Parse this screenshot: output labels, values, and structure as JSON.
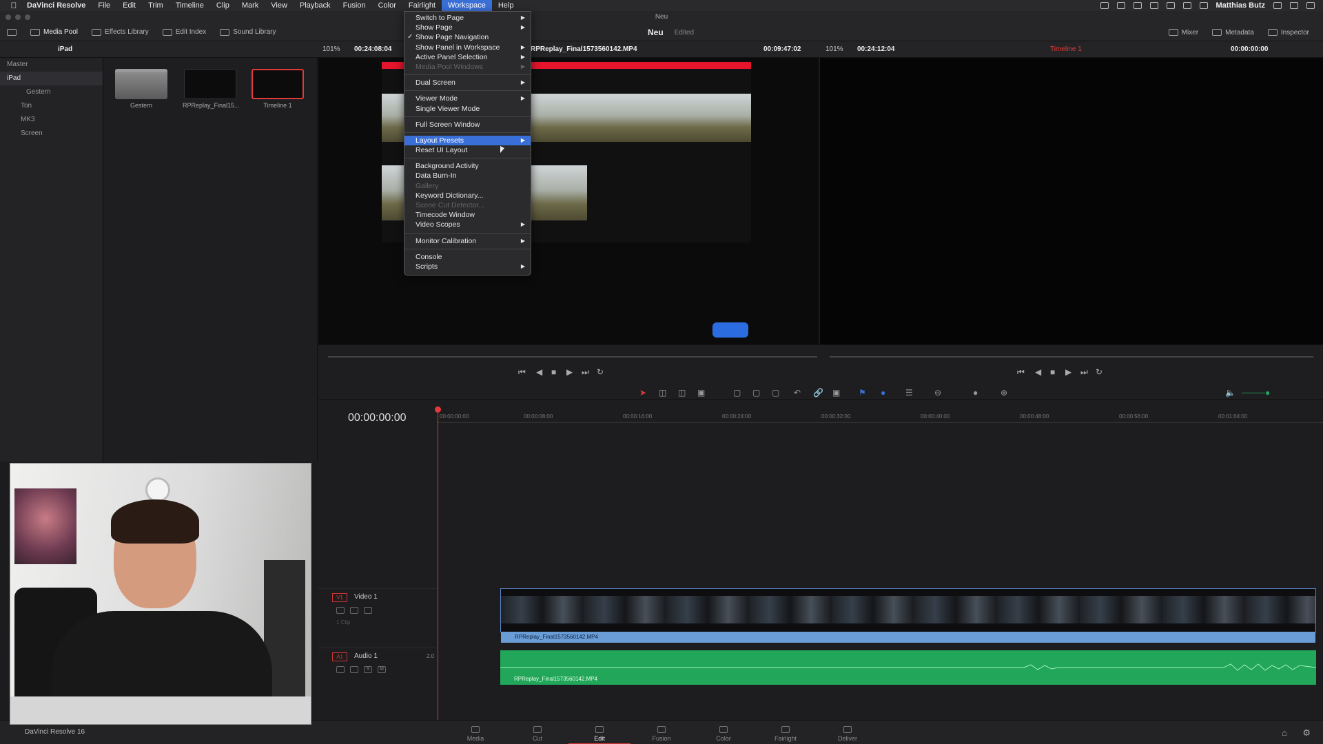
{
  "menubar": {
    "app_name": "DaVinci Resolve",
    "items": [
      "File",
      "Edit",
      "Trim",
      "Timeline",
      "Clip",
      "Mark",
      "View",
      "Playback",
      "Fusion",
      "Color",
      "Fairlight",
      "Workspace",
      "Help"
    ],
    "active_item": "Workspace",
    "user_name": "Matthias Butz"
  },
  "window": {
    "title": "Neu"
  },
  "toolbar": {
    "media_pool": "Media Pool",
    "effects_library": "Effects Library",
    "edit_index": "Edit Index",
    "sound_library": "Sound Library",
    "project_name": "Neu",
    "project_status": "Edited",
    "mixer": "Mixer",
    "metadata": "Metadata",
    "inspector": "Inspector"
  },
  "poolbar": {
    "bin_name": "iPad",
    "source_zoom": "101%",
    "source_duration": "00:24:08:04",
    "source_clip": "RPReplay_Final1573560142.MP4",
    "source_timecode": "00:09:47:02",
    "timeline_zoom": "101%",
    "timeline_duration": "00:24:12:04",
    "timeline_name": "Timeline 1",
    "timeline_timecode": "00:00:00:00"
  },
  "bins": [
    {
      "label": "Master",
      "level": 0
    },
    {
      "label": "iPad",
      "level": 1,
      "selected": true
    },
    {
      "label": "Gestern",
      "level": 2
    },
    {
      "label": "Ton",
      "level": 1
    },
    {
      "label": "MK3",
      "level": 1
    },
    {
      "label": "Screen",
      "level": 1
    }
  ],
  "thumbnails": [
    {
      "label": "Gestern",
      "kind": "folder"
    },
    {
      "label": "RPReplay_Final15...",
      "kind": "clip"
    },
    {
      "label": "Timeline 1",
      "kind": "timeline"
    }
  ],
  "workspace_menu": [
    {
      "label": "Switch to Page",
      "submenu": true
    },
    {
      "label": "Show Page",
      "submenu": true
    },
    {
      "label": "Show Page Navigation",
      "checked": true
    },
    {
      "label": "Show Panel in Workspace",
      "submenu": true
    },
    {
      "label": "Active Panel Selection",
      "submenu": true
    },
    {
      "label": "Media Pool Windows",
      "disabled": true,
      "submenu": true
    },
    {
      "sep": true
    },
    {
      "label": "Dual Screen",
      "submenu": true
    },
    {
      "sep": true
    },
    {
      "label": "Viewer Mode",
      "submenu": true
    },
    {
      "label": "Single Viewer Mode"
    },
    {
      "sep": true
    },
    {
      "label": "Full Screen Window"
    },
    {
      "sep": true
    },
    {
      "label": "Layout Presets",
      "submenu": true,
      "hover": true
    },
    {
      "label": "Reset UI Layout"
    },
    {
      "sep": true
    },
    {
      "label": "Background Activity"
    },
    {
      "label": "Data Burn-In"
    },
    {
      "label": "Gallery",
      "disabled": true
    },
    {
      "label": "Keyword Dictionary..."
    },
    {
      "label": "Scene Cut Detector...",
      "disabled": true
    },
    {
      "label": "Timecode Window"
    },
    {
      "label": "Video Scopes",
      "submenu": true
    },
    {
      "sep": true
    },
    {
      "label": "Monitor Calibration",
      "submenu": true
    },
    {
      "sep": true
    },
    {
      "label": "Console"
    },
    {
      "label": "Scripts",
      "submenu": true
    }
  ],
  "timeline": {
    "timecode": "00:00:00:00",
    "ruler_ticks": [
      "00:00:00:00",
      "00:00:08:00",
      "00:00:16:00",
      "00:00:24:00",
      "00:00:32:00",
      "00:00:40:00",
      "00:00:48:00",
      "00:00:56:00",
      "00:01:04:00"
    ],
    "video_track": {
      "badge": "V1",
      "name": "Video 1",
      "clip_count": "1 Clip",
      "clip_name": "RPReplay_Final1573560142.MP4"
    },
    "audio_track": {
      "badge": "A1",
      "name": "Audio 1",
      "channel": "2.0",
      "clip_name": "RPReplay_Final1573560142.MP4",
      "solo": "S",
      "mute": "M"
    }
  },
  "pages": {
    "brand": "DaVinci Resolve 16",
    "tabs": [
      "Media",
      "Cut",
      "Edit",
      "Fusion",
      "Color",
      "Fairlight",
      "Deliver"
    ],
    "active": "Edit"
  },
  "colors": {
    "accent_red": "#e23a3a",
    "menu_highlight": "#3a6fd8",
    "video_clip": "#6a9cd6",
    "audio_clip": "#21a65a"
  }
}
